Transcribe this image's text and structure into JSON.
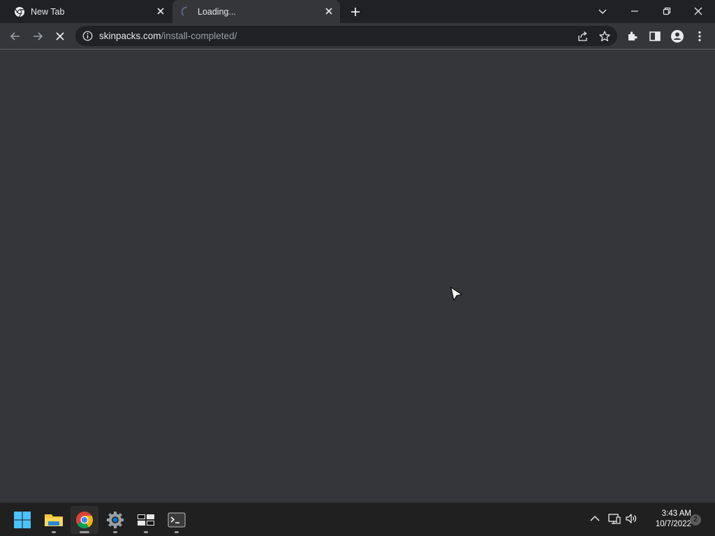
{
  "tabs": [
    {
      "title": "New Tab",
      "icon": "chrome-icon",
      "active": false
    },
    {
      "title": "Loading...",
      "icon": "loading-spinner-icon",
      "active": true
    }
  ],
  "omnibox": {
    "host": "skinpacks.com",
    "path": "/install-completed/"
  },
  "clock": {
    "time": "3:43 AM",
    "date": "10/7/2022"
  },
  "notification_count": "2",
  "taskbar_apps": [
    "start-icon",
    "file-explorer-icon",
    "chrome-icon",
    "settings-icon",
    "task-view-icon",
    "terminal-icon"
  ],
  "colors": {
    "frame": "#202124",
    "toolbar": "#35363a",
    "taskbar": "#202020"
  }
}
